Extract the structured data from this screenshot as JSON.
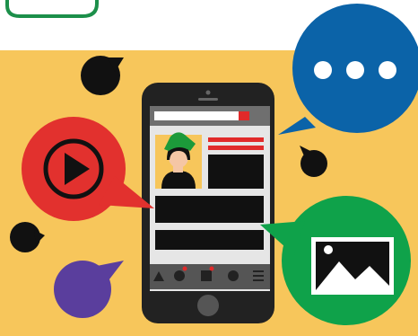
{
  "illustration": {
    "subject": "social-media-content-on-smartphone",
    "icons": [
      "play-icon",
      "more-dots-icon",
      "image-landscape-icon",
      "avatar-icon"
    ],
    "colors": {
      "background": "#f7c65b",
      "phone_body": "#222222",
      "screen": "#e6e6e6",
      "search_bar": "#6f6f6f",
      "accent_red": "#e12a2a",
      "bubble_blue": "#0b63a8",
      "bubble_red": "#e2312e",
      "bubble_green": "#0fa24a",
      "bubble_purple": "#5a3e9d",
      "bubble_black": "#111111",
      "avatar_hat": "#1c9a3a",
      "avatar_skin": "#f5c6a5",
      "top_tab_border": "#1c8f4a"
    }
  }
}
